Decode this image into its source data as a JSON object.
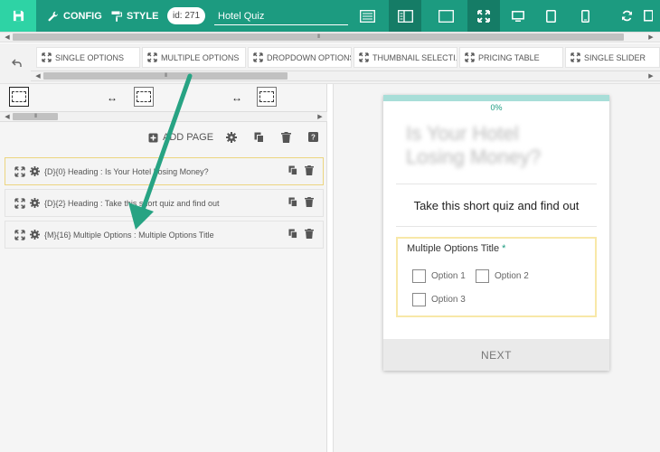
{
  "toolbar": {
    "config_label": "CONFIG",
    "style_label": "STYLE",
    "form_id": "id: 271",
    "form_title": "Hotel Quiz",
    "view_icons": [
      "layout-full-icon",
      "layout-split-icon",
      "layout-blank-icon",
      "fullscreen-icon"
    ],
    "device_icons": [
      "desktop-icon",
      "tablet-icon",
      "mobile-icon",
      "refresh-icon"
    ]
  },
  "components": {
    "items": [
      {
        "label": "SINGLE OPTIONS"
      },
      {
        "label": "MULTIPLE OPTIONS"
      },
      {
        "label": "DROPDOWN OPTIONS"
      },
      {
        "label": "THUMBNAIL SELECTI..."
      },
      {
        "label": "PRICING TABLE"
      },
      {
        "label": "SINGLE SLIDER"
      }
    ]
  },
  "builder": {
    "add_page_label": "ADD PAGE",
    "items": [
      {
        "label": "{D}{0} Heading : Is Your Hotel Losing Money?",
        "selected": true
      },
      {
        "label": "{D}{2} Heading : Take this short quiz and find out",
        "selected": false
      },
      {
        "label": "{M}{16} Multiple Options : Multiple Options Title",
        "selected": false
      }
    ]
  },
  "preview": {
    "progress_value": 0,
    "progress_text": "0%",
    "heading": "Is Your Hotel Losing Money?",
    "subheading": "Take this short quiz and find out",
    "question_title": "Multiple Options Title",
    "required_mark": "*",
    "options": [
      "Option 1",
      "Option 2",
      "Option 3"
    ],
    "next_label": "NEXT"
  },
  "colors": {
    "topbar": "#1c9b80",
    "save_button": "#2ed3a5",
    "annotation_arrow": "#27a383",
    "selected_border": "#ecd580"
  }
}
